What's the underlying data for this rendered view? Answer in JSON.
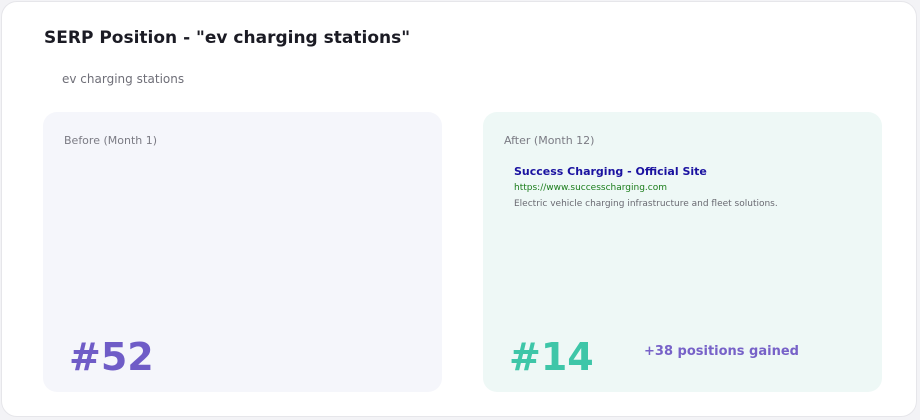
{
  "title": "SERP Position - \"ev charging stations\"",
  "keyword": "ev charging stations",
  "before": {
    "label": "Before (Month 1)",
    "rank": "#52",
    "rank_color": "#6f5cc7"
  },
  "after": {
    "label": "After (Month 12)",
    "rank": "#14",
    "rank_color": "#3ec6a8",
    "result": {
      "title": "Success Charging - Official Site",
      "url": "https://www.successcharging.com",
      "description": "Electric vehicle charging infrastructure and fleet solutions."
    },
    "gain": "+38 positions gained"
  },
  "colors": {
    "before_panel_bg": "#f5f6fb",
    "after_panel_bg": "#eef8f6",
    "gain_text": "#7762c8",
    "result_title": "#1a12a0",
    "result_url": "#1b7d1b"
  }
}
